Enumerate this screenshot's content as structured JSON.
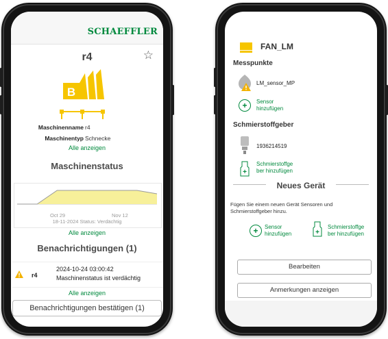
{
  "left": {
    "brand": "SCHAEFFLER",
    "machine_title": "r4",
    "machine_name_label": "Maschinenname",
    "machine_name_value": "r4",
    "machine_type_label": "Maschinentyp",
    "machine_type_value": "Schnecke",
    "show_all_1": "Alle anzeigen",
    "status_heading": "Maschinenstatus",
    "chart_data": {
      "type": "area",
      "x_tick_labels": [
        "Oct 29",
        "Nov 12"
      ],
      "series": [
        {
          "values": [
            0,
            0,
            1,
            1,
            1,
            1,
            1,
            0.75
          ]
        }
      ]
    },
    "status_line": "18-11-2024 Status: Verdächtig",
    "show_all_2": "Alle anzeigen",
    "notifications_heading": "Benachrichtigungen (1)",
    "notification": {
      "machine": "r4",
      "time": "2024-10-24 03:00:42",
      "message": "Maschinenstatus ist  verdächtig"
    },
    "show_all_3": "Alle anzeigen",
    "confirm_button": "Benachrichtigungen bestätigen (1)"
  },
  "right": {
    "device_title": "FAN_LM",
    "measure_points_heading": "Messpunkte",
    "sensor_name": "LM_sensor_MP",
    "add_sensor_line1": "Sensor",
    "add_sensor_line2": "hinzufügen",
    "lubricator_heading": "Schmierstoffgeber",
    "lubricator_id": "1936214519",
    "add_lub_line1": "Schmierstoffge",
    "add_lub_line2": "ber hinzufügen",
    "new_device_heading": "Neues Gerät",
    "info_text": "Fügen Sie einem neuen Gerät Sensoren und Schmierstoffgeber hinzu.",
    "new_sensor_line1": "Sensor",
    "new_sensor_line2": "hinzufügen",
    "new_lub_line1": "Schmierstoffge",
    "new_lub_line2": "ber hinzufügen",
    "edit_button": "Bearbeiten",
    "notes_button": "Anmerkungen anzeigen"
  },
  "colors": {
    "brand_green": "#00893d",
    "machine_yellow": "#f6c500",
    "chart_yellow": "#f7f09a",
    "warning": "#f3b200"
  }
}
